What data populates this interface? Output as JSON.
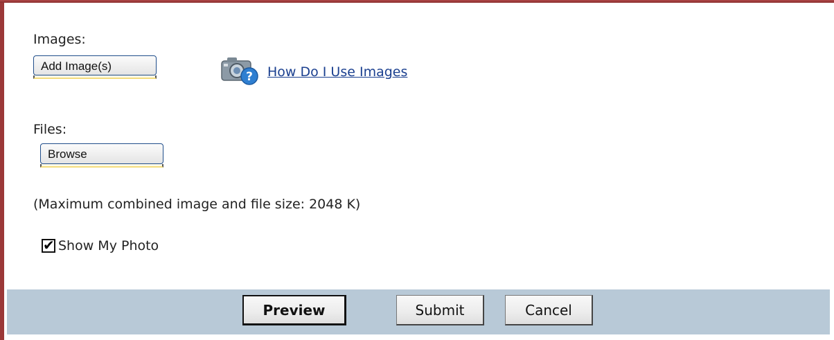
{
  "images": {
    "label": "Images:",
    "add_button_label": "Add Image(s)",
    "help_icon": "camera-help-icon",
    "help_link_text": "How Do I Use Images"
  },
  "files": {
    "label": "Files:",
    "browse_button_label": "Browse"
  },
  "size_note": "(Maximum combined image and file size: 2048 K)",
  "show_photo": {
    "checked": true,
    "label": "Show My Photo"
  },
  "actions": {
    "preview_label": "Preview",
    "submit_label": "Submit",
    "cancel_label": "Cancel"
  },
  "colors": {
    "frame_border": "#9b3838",
    "link": "#1a3f8f",
    "action_bar": "#b8c9d7",
    "button_border": "#1f4d8a"
  }
}
